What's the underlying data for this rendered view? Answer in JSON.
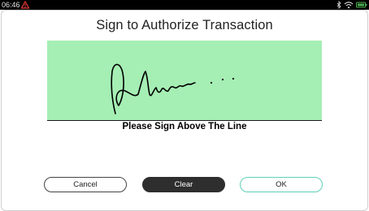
{
  "status_bar": {
    "time": "06:46",
    "icons": [
      "warning-icon",
      "bluetooth-icon",
      "wifi-icon",
      "battery-icon"
    ]
  },
  "title": "Sign to Authorize Transaction",
  "signature_pad": {
    "background_color": "#a5eeb4",
    "instruction": "Please Sign Above The Line"
  },
  "buttons": {
    "cancel": "Cancel",
    "clear": "Clear",
    "ok": "OK"
  },
  "colors": {
    "ok_border": "#5fd0b8",
    "clear_background": "#2e2e2e",
    "warning": "#e53935",
    "battery": "#4caf50"
  }
}
